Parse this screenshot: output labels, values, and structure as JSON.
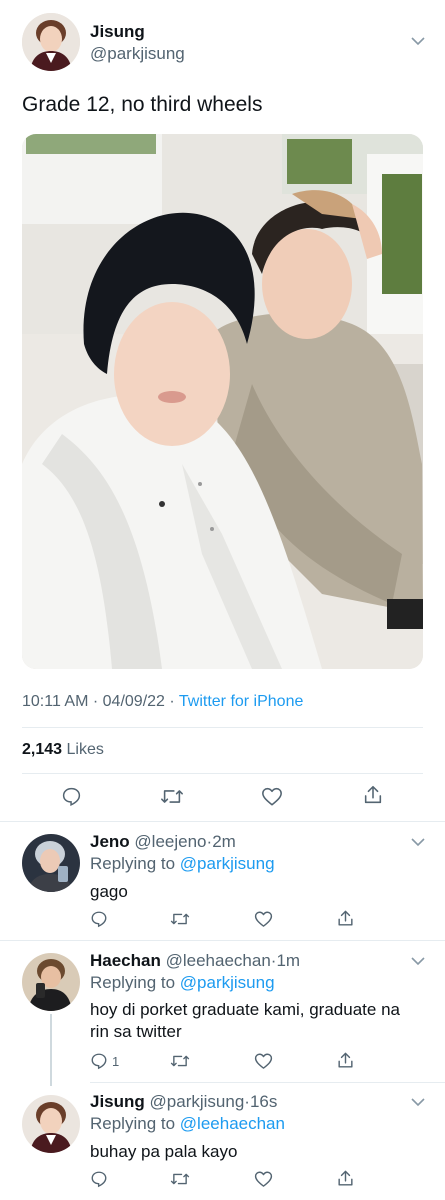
{
  "main_tweet": {
    "display_name": "Jisung",
    "handle": "@parkjisung",
    "text": "Grade 12, no third wheels",
    "time": "10:11 AM",
    "dot1": "·",
    "date": "04/09/22",
    "dot2": "·",
    "source": "Twitter for iPhone",
    "likes_count": "2,143",
    "likes_label": "Likes"
  },
  "replies": [
    {
      "display_name": "Jeno",
      "handle": "@leejeno",
      "dot": "·",
      "time": "2m",
      "replying_prefix": "Replying to",
      "replying_to": "@parkjisung",
      "text": "gago",
      "reply_count": ""
    },
    {
      "display_name": "Haechan",
      "handle": "@leehaechan",
      "dot": "·",
      "time": "1m",
      "replying_prefix": "Replying to",
      "replying_to": "@parkjisung",
      "text_line1": "hoy di porket graduate kami, graduate na",
      "text_line2": "rin sa twitter",
      "reply_count": "1"
    },
    {
      "display_name": "Jisung",
      "handle": "@parkjisung",
      "dot": "·",
      "time": "16s",
      "replying_prefix": "Replying to",
      "replying_to": "@leehaechan",
      "text": "buhay pa pala kayo",
      "reply_count": ""
    }
  ],
  "icons": [
    "chevron-down-icon",
    "reply-icon",
    "retweet-icon",
    "like-icon",
    "share-icon"
  ],
  "colors": {
    "link": "#1d9bf0",
    "muted": "#536471",
    "text": "#0f1419",
    "divider": "#e6ecf0"
  }
}
